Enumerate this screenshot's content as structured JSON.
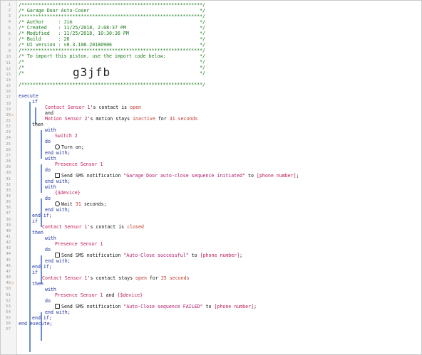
{
  "piston": {
    "import_code": "g3jfb",
    "header": [
      "/****************************************************************/",
      "/* Garage Door Auto-Coser                                       */",
      "/****************************************************************/",
      "/* Author     : Jim                                             */",
      "/* Created    : 11/25/2018, 2:08:37 PM                          */",
      "/* Modified   : 11/25/2018, 10:30:36 PM                         */",
      "/* Build      : 20                                              */",
      "/* UI version : v0.3.108.20180906                               */",
      "/****************************************************************/",
      "/* To import this piston, use the import code below:            */",
      "/*                                                              */",
      "/*                                                              */",
      "/*                                                              */",
      "/****************************************************************/"
    ],
    "kw": {
      "execute": "execute",
      "if": "if",
      "and": "and",
      "then": "then",
      "with": "with",
      "do": "do",
      "end_with": "end with;",
      "end_if": "end if;",
      "end_execute": "end execute;"
    },
    "dev": {
      "contact1": "Contact Sensor 1",
      "motion2": "Motion Sensor 2",
      "switch2": "Switch 2",
      "presence1": "Presence Sensor 1",
      "device_var": "{$device}"
    },
    "text": {
      "contact_is": "'s contact is",
      "motion_stays": "'s motion stays",
      "for": "for",
      "seconds": "seconds",
      "turn_on": "Turn on;",
      "send_sms": "Send SMS notification",
      "to": "to",
      "wait": "Wait",
      "seconds_semi": "seconds;",
      "contact_stays": "'s contact stays",
      "and_sep": "and"
    },
    "values": {
      "open": "open",
      "inactive": "inactive",
      "closed": "closed",
      "t31": "31",
      "t25": "25",
      "phone": "[phone number]",
      "msg1": "\"Garage Door auto-close sequence initiated\"",
      "msg2": "\"Auto-Close successful\"",
      "msg3": "\"Auto-Close sequence FAILED\""
    },
    "line_numbers": [
      "1",
      "2",
      "3",
      "4",
      "5",
      "6",
      "7",
      "8",
      "9",
      "10",
      "11",
      "12",
      "13",
      "14",
      "15",
      "16",
      "17",
      "18",
      "19",
      "20",
      "21",
      "22",
      "23",
      "24",
      "25",
      "26",
      "27",
      "28",
      "29",
      "30",
      "31",
      "32",
      "33",
      "34",
      "35",
      "36",
      "37",
      "38",
      "39",
      "40",
      "41",
      "42",
      "43",
      "44",
      "45",
      "46",
      "47",
      "48",
      "49",
      "50",
      "51",
      "52",
      "53",
      "54",
      "55",
      "56",
      "57"
    ],
    "warning_marks": [
      "20",
      "49"
    ]
  },
  "colors": {
    "comment": "#1a7a1a",
    "keyword": "#1a2fa0",
    "device": "#c0185a",
    "value": "#c0392b",
    "string": "#b0166a",
    "warning": "#e07a2a"
  }
}
